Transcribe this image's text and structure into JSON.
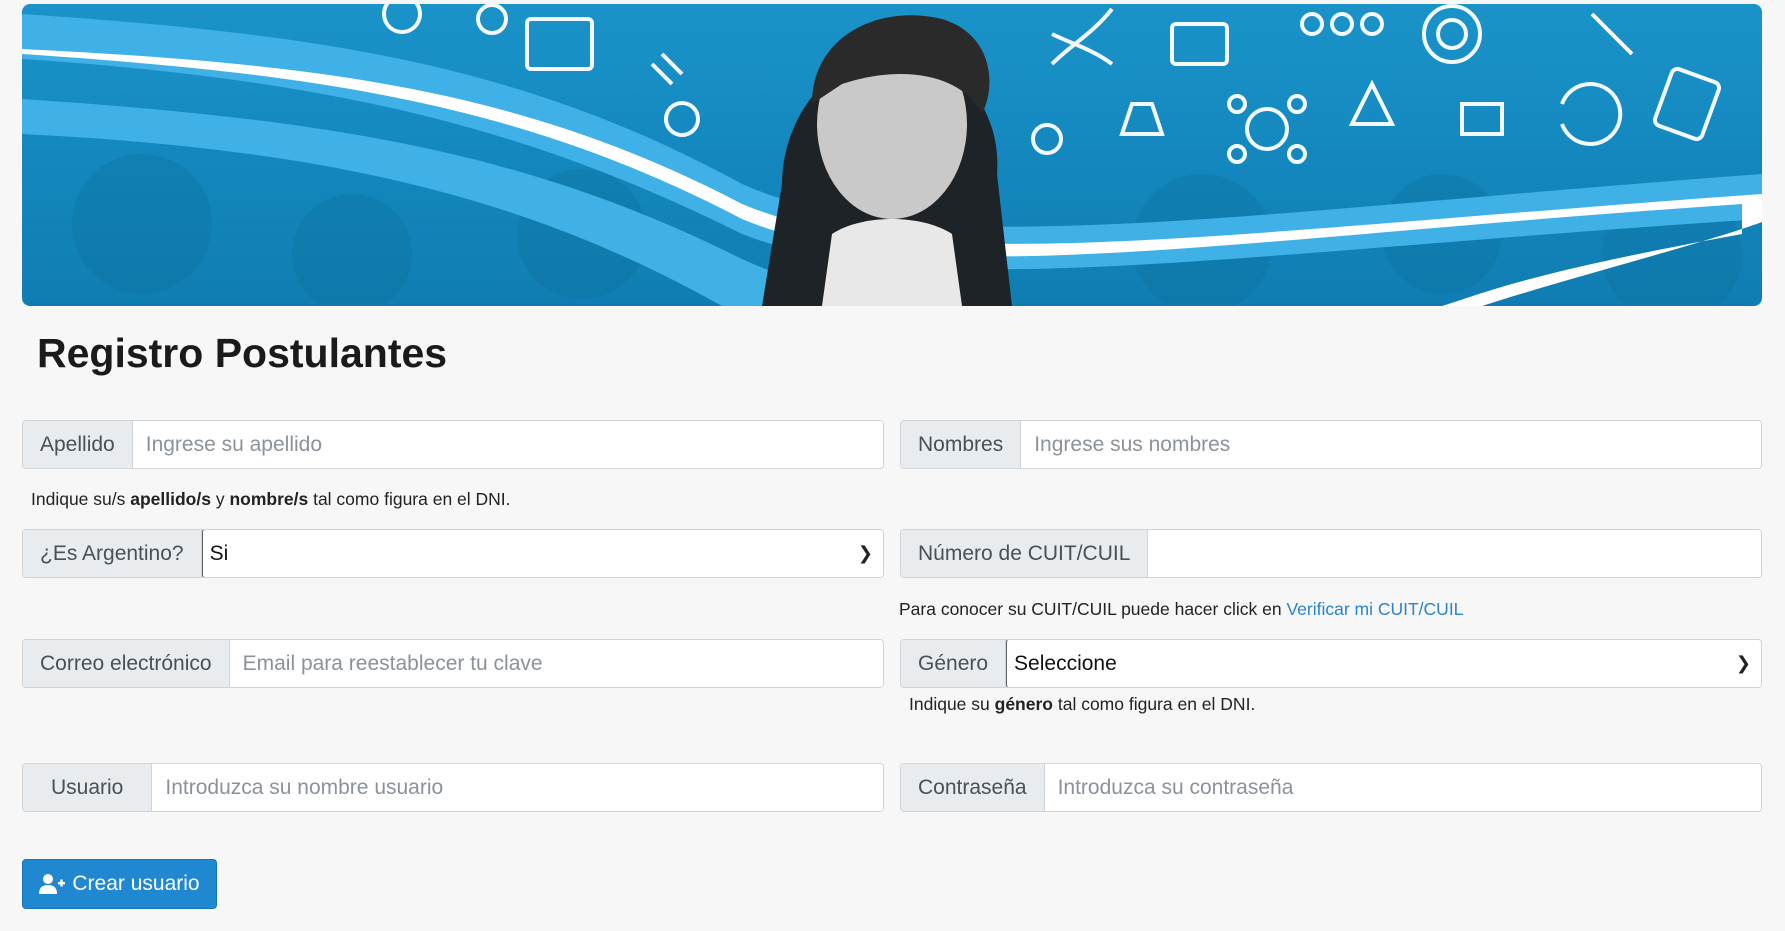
{
  "page": {
    "title": "Registro Postulantes"
  },
  "form": {
    "apellido": {
      "label": "Apellido",
      "placeholder": "Ingrese su apellido"
    },
    "nombres": {
      "label": "Nombres",
      "placeholder": "Ingrese sus nombres"
    },
    "help_names": {
      "pre": "Indique su/s ",
      "b1": "apellido/s",
      "mid": " y ",
      "b2": "nombre/s",
      "post": " tal como figura en el DNI."
    },
    "argentino": {
      "label": "¿Es Argentino?",
      "value": "Si"
    },
    "cuit": {
      "label": "Número de CUIT/CUIL",
      "value": ""
    },
    "help_cuit": {
      "pre": "Para conocer su CUIT/CUIL puede hacer click en ",
      "link": "Verificar mi CUIT/CUIL"
    },
    "email": {
      "label": "Correo electrónico",
      "placeholder": "Email para reestablecer tu clave"
    },
    "genero": {
      "label": "Género",
      "value": "Seleccione"
    },
    "help_genero": {
      "pre": "Indique su ",
      "b": "género",
      "post": " tal como figura en el DNI."
    },
    "usuario": {
      "label": "Usuario",
      "placeholder": "Introduzca su nombre usuario"
    },
    "password": {
      "label": "Contraseña",
      "placeholder": "Introduzca su contraseña"
    },
    "submit": {
      "label": "Crear usuario",
      "icon": "user-plus-icon"
    }
  },
  "colors": {
    "banner_blue": "#1a93c9",
    "button_blue": "#1f88d1",
    "link_blue": "#2a85c9"
  }
}
